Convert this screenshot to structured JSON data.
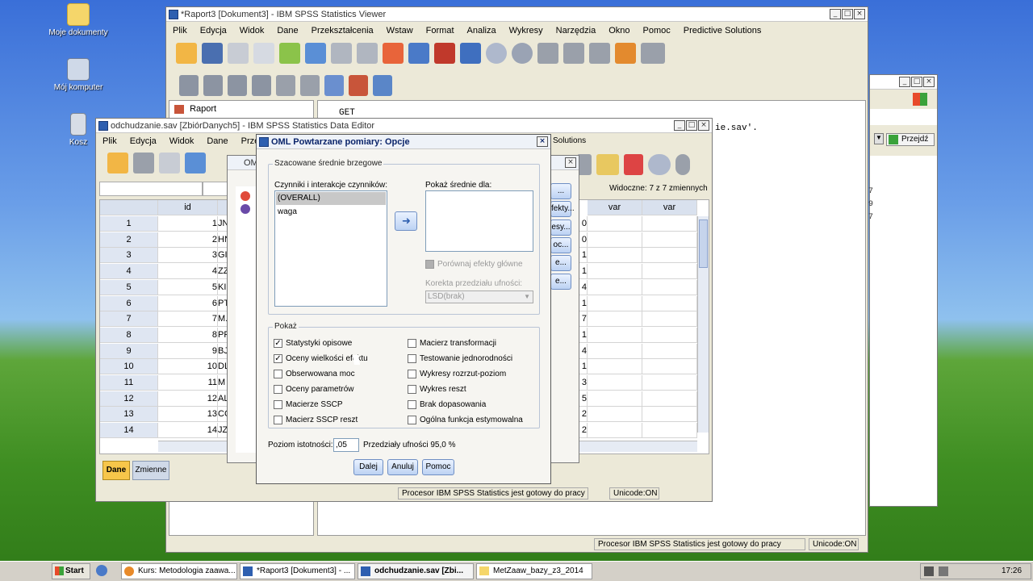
{
  "desktop": {
    "icons": [
      {
        "label": "Moje dokumenty"
      },
      {
        "label": "Mój komputer"
      },
      {
        "label": "Kosz"
      }
    ]
  },
  "viewer": {
    "title": "*Raport3 [Dokument3] - IBM SPSS Statistics Viewer",
    "menu": [
      "Plik",
      "Edycja",
      "Widok",
      "Dane",
      "Przekształcenia",
      "Wstaw",
      "Format",
      "Analiza",
      "Wykresy",
      "Narzędzia",
      "Okno",
      "Pomoc",
      "Predictive Solutions"
    ],
    "tree_item": "Raport",
    "syntax_line1": "GET",
    "syntax_line2": "ie.sav'.",
    "right_numbers": [
      "7",
      "9",
      "7"
    ],
    "status_processor": "Procesor IBM SPSS Statistics  jest gotowy do pracy",
    "status_unicode": "Unicode:ON"
  },
  "bgwin": {
    "goto_label": "Przejdź"
  },
  "editor": {
    "title": "odchudzanie.sav [ZbiórDanych5] - IBM SPSS Statistics Data Editor",
    "menu": [
      "Plik",
      "Edycja",
      "Widok",
      "Dane",
      "Przeks"
    ],
    "menu_right": "Solutions",
    "visible_vars": "Widoczne: 7 z 7 zmiennych",
    "col_id": "id",
    "col_var1": "var",
    "col_var2": "var",
    "rows": [
      {
        "n": "1",
        "id": "1",
        "c": "JN",
        "r": "0"
      },
      {
        "n": "2",
        "id": "2",
        "c": "HN",
        "r": "0"
      },
      {
        "n": "3",
        "id": "3",
        "c": "GI",
        "r": "1"
      },
      {
        "n": "4",
        "id": "4",
        "c": "ZZ",
        "r": "1"
      },
      {
        "n": "5",
        "id": "5",
        "c": "KI",
        "r": "4"
      },
      {
        "n": "6",
        "id": "6",
        "c": "PT",
        "r": "1"
      },
      {
        "n": "7",
        "id": "7",
        "c": "M.",
        "r": "7"
      },
      {
        "n": "8",
        "id": "8",
        "c": "PF",
        "r": "1"
      },
      {
        "n": "9",
        "id": "9",
        "c": "BJ",
        "r": "4"
      },
      {
        "n": "10",
        "id": "10",
        "c": "DL",
        "r": "1"
      },
      {
        "n": "11",
        "id": "11",
        "c": "M",
        "r": "3"
      },
      {
        "n": "12",
        "id": "12",
        "c": "AL",
        "r": "5"
      },
      {
        "n": "13",
        "id": "13",
        "c": "CC",
        "r": "2"
      },
      {
        "n": "14",
        "id": "14",
        "c": "JZ",
        "r": "2"
      }
    ],
    "tab_data": "Dane",
    "tab_vars": "Zmienne",
    "status_processor": "Procesor IBM SPSS Statistics  jest gotowy do pracy",
    "status_unicode": "Unicode:ON"
  },
  "glm_dialog": {
    "title": "OML",
    "side_buttons": [
      "...",
      "fekty...",
      "esy...",
      "oc...",
      "e...",
      "e..."
    ]
  },
  "options": {
    "title": "OML Powtarzane pomiary: Opcje",
    "group1_title": "Szacowane średnie brzegowe",
    "factors_label": "Czynniki i interakcje czynników:",
    "factors": [
      "(OVERALL)",
      "waga"
    ],
    "means_label": "Pokaż średnie dla:",
    "compare_label": "Porównaj efekty główne",
    "ci_label": "Korekta przedziału ufności:",
    "ci_value": "LSD(brak)",
    "group2_title": "Pokaż",
    "checks_left": [
      {
        "label": "Statystyki opisowe",
        "checked": true
      },
      {
        "label": "Oceny wielkości efektu",
        "checked": true
      },
      {
        "label": "Obserwowana moc",
        "checked": false
      },
      {
        "label": "Oceny parametrów",
        "checked": false
      },
      {
        "label": "Macierze SSCP",
        "checked": false
      },
      {
        "label": "Macierz SSCP reszt",
        "checked": false
      }
    ],
    "checks_right": [
      {
        "label": "Macierz transformacji",
        "checked": false
      },
      {
        "label": "Testowanie jednorodności",
        "checked": false
      },
      {
        "label": "Wykresy rozrzut-poziom",
        "checked": false
      },
      {
        "label": "Wykres reszt",
        "checked": false
      },
      {
        "label": "Brak dopasowania",
        "checked": false
      },
      {
        "label": "Ogólna funkcja estymowalna",
        "checked": false
      }
    ],
    "sig_label": "Poziom istotności:",
    "sig_value": ",05",
    "ci_text": "Przedziały ufności 95,0 %",
    "btn_next": "Dalej",
    "btn_cancel": "Anuluj",
    "btn_help": "Pomoc"
  },
  "taskbar": {
    "start": "Start",
    "items": [
      "Kurs: Metodologia zaawa...",
      "*Raport3 [Dokument3] - ...",
      "odchudzanie.sav [Zbi...",
      "MetZaaw_bazy_z3_2014"
    ],
    "clock": "17:26"
  },
  "colors": {
    "accent": "#2e5fb0",
    "dialog_title": "#0a246a",
    "taskbar": "#d4d0c8"
  }
}
